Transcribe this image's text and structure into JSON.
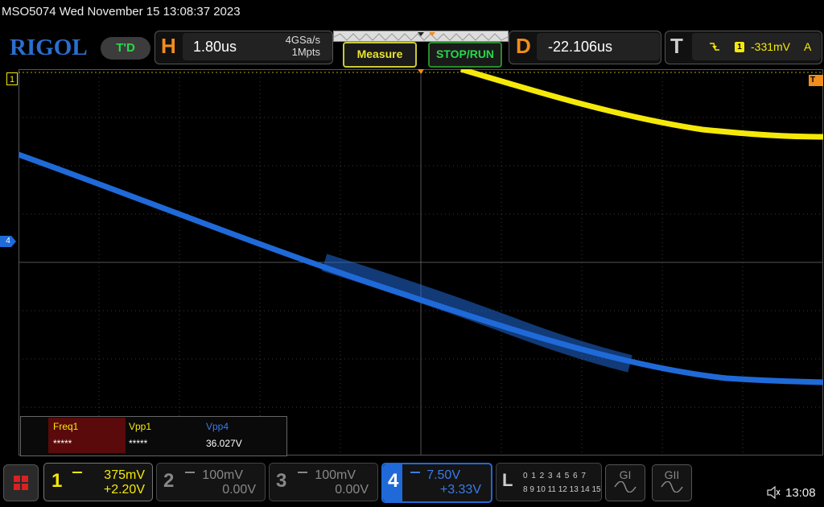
{
  "header": {
    "title": "MSO5074  Wed November 15 13:08:37 2023",
    "logo": "RIGOL",
    "mode_badge": "T'D"
  },
  "horizontal": {
    "letter": "H",
    "timebase": "1.80us",
    "sample_rate": "4GSa/s",
    "memory_depth": "1Mpts"
  },
  "buttons": {
    "measure": "Measure",
    "stop_run": "STOP/RUN"
  },
  "delay": {
    "letter": "D",
    "value": "-22.106us"
  },
  "trigger": {
    "letter": "T",
    "source": "1",
    "level": "-331mV",
    "mode": "A",
    "color": "#f5e90a"
  },
  "markers": {
    "ch1": "1",
    "ch4": "4",
    "trigger_level": "T"
  },
  "measurements": {
    "headers": [
      "Freq1",
      "Vpp1",
      "Vpp4"
    ],
    "values": [
      "*****",
      "*****",
      "36.027V"
    ],
    "colors": [
      "#f5e90a",
      "#f5e90a",
      "#3a7bea"
    ]
  },
  "channels": [
    {
      "num": "1",
      "scale": "375mV",
      "offset": "+2.20V",
      "color": "#f5e90a",
      "active": true
    },
    {
      "num": "2",
      "scale": "100mV",
      "offset": "0.00V",
      "color": "#888888",
      "active": false
    },
    {
      "num": "3",
      "scale": "100mV",
      "offset": "0.00V",
      "color": "#888888",
      "active": false
    },
    {
      "num": "4",
      "scale": "7.50V",
      "offset": "+3.33V",
      "color": "#3a7bea",
      "active": true
    }
  ],
  "logic": {
    "letter": "L",
    "row1": "0 1 2 3  4 5 6 7",
    "row2": "8 9 10 11 12 13 14 15"
  },
  "generators": [
    "GI",
    "GII"
  ],
  "status": {
    "clock": "13:08"
  },
  "colors": {
    "ch1": "#f5e90a",
    "ch4": "#1f6ad8",
    "accent_orange": "#f28c1c",
    "accent_green": "#27d94a"
  }
}
